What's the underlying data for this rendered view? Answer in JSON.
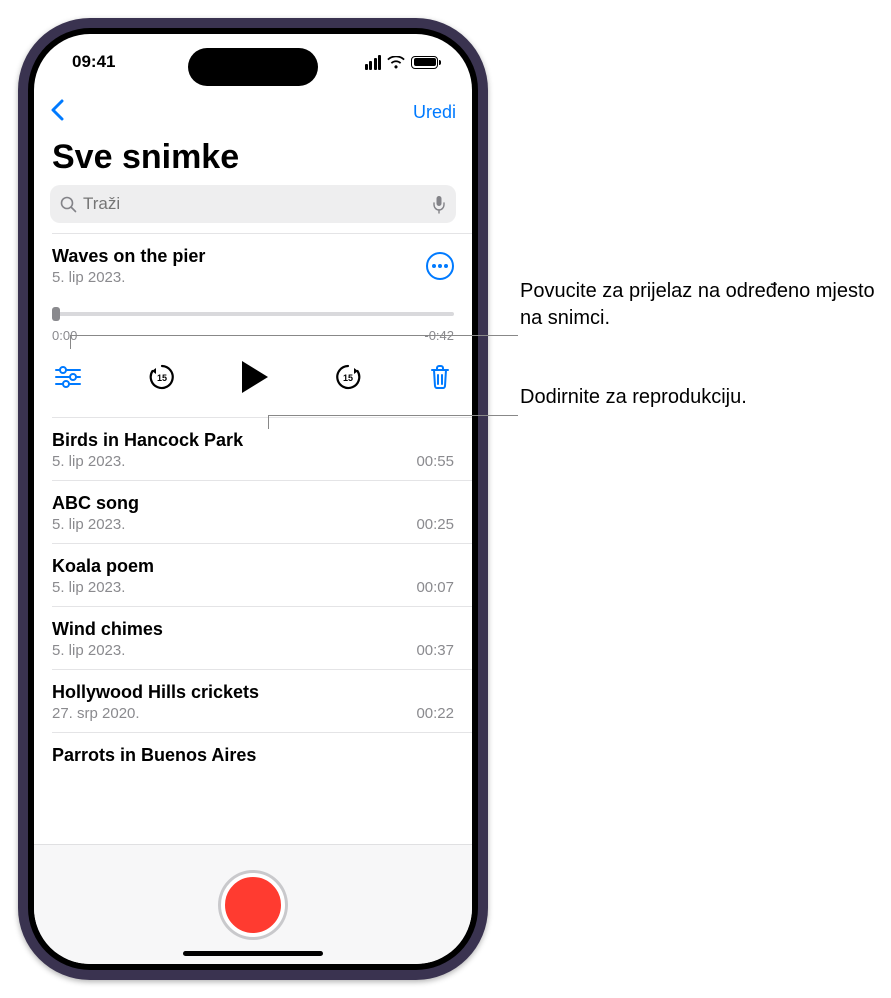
{
  "status": {
    "time": "09:41"
  },
  "nav": {
    "edit": "Uredi"
  },
  "title": "Sve snimke",
  "search": {
    "placeholder": "Traži"
  },
  "selected": {
    "title": "Waves on the pier",
    "date": "5. lip 2023.",
    "elapsed": "0:00",
    "remaining": "-0:42"
  },
  "recordings": [
    {
      "title": "Birds in Hancock Park",
      "date": "5. lip 2023.",
      "duration": "00:55"
    },
    {
      "title": "ABC song",
      "date": "5. lip 2023.",
      "duration": "00:25"
    },
    {
      "title": "Koala poem",
      "date": "5. lip 2023.",
      "duration": "00:07"
    },
    {
      "title": "Wind chimes",
      "date": "5. lip 2023.",
      "duration": "00:37"
    },
    {
      "title": "Hollywood Hills crickets",
      "date": "27. srp 2020.",
      "duration": "00:22"
    },
    {
      "title": "Parrots in Buenos Aires",
      "date": "",
      "duration": ""
    }
  ],
  "callouts": {
    "scrub": "Povucite za prijelaz na određeno mjesto na snimci.",
    "play": "Dodirnite za reprodukciju."
  }
}
